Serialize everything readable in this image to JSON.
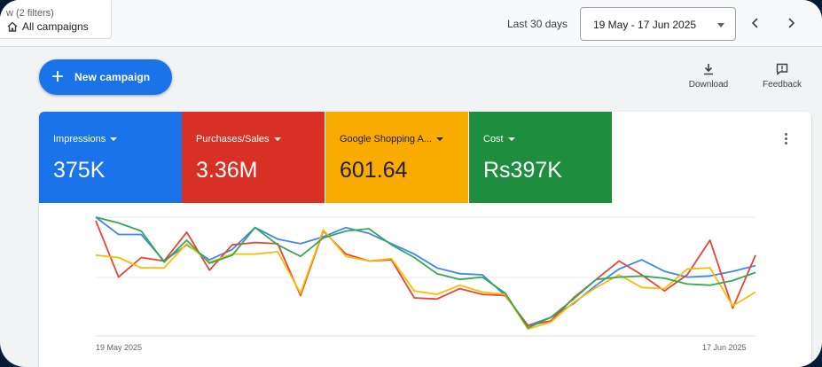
{
  "filter": {
    "hint": "w (2 filters)",
    "label": "All campaigns"
  },
  "date": {
    "range_label": "Last 30 days",
    "range": "19 May - 17 Jun 2025"
  },
  "toolbar": {
    "new_campaign": "New campaign",
    "download": "Download",
    "feedback": "Feedback"
  },
  "metrics": [
    {
      "label": "Impressions",
      "value": "375K",
      "color": "#1a73e8"
    },
    {
      "label": "Purchases/Sales",
      "value": "3.36M",
      "color": "#d93025"
    },
    {
      "label": "Google Shopping A...",
      "value": "601.64",
      "color": "#f9ab00"
    },
    {
      "label": "Cost",
      "value": "Rs397K",
      "color": "#1e8e3e"
    }
  ],
  "chart_data": {
    "type": "line",
    "x_start_label": "19 May 2025",
    "x_end_label": "17 Jun 2025",
    "grid": true,
    "series": [
      {
        "name": "Impressions",
        "color": "#4285f4",
        "values": [
          100,
          85,
          85,
          62,
          76,
          63,
          72,
          91,
          81,
          77,
          83,
          91,
          86,
          77,
          68,
          56,
          51,
          50,
          32,
          6,
          13,
          25,
          41,
          55,
          63,
          53,
          48,
          49,
          53,
          58
        ]
      },
      {
        "name": "Purchases/Sales",
        "color": "#ea4335",
        "values": [
          97,
          48,
          65,
          62,
          87,
          54,
          76,
          78,
          77,
          32,
          88,
          68,
          62,
          63,
          30,
          29,
          38,
          33,
          32,
          6,
          10,
          30,
          46,
          62,
          50,
          36,
          50,
          80,
          21,
          67
        ]
      },
      {
        "name": "Google Shopping A...",
        "color": "#fbbc04",
        "values": [
          67,
          65,
          56,
          56,
          77,
          61,
          68,
          68,
          70,
          34,
          89,
          66,
          62,
          64,
          36,
          33,
          41,
          35,
          33,
          3,
          9,
          26,
          39,
          50,
          39,
          38,
          55,
          56,
          23,
          35
        ]
      },
      {
        "name": "Cost",
        "color": "#34a853",
        "values": [
          100,
          95,
          88,
          61,
          80,
          60,
          67,
          91,
          76,
          66,
          82,
          88,
          90,
          76,
          65,
          51,
          46,
          48,
          34,
          4,
          13,
          29,
          46,
          48,
          49,
          47,
          42,
          41,
          45,
          52
        ]
      }
    ]
  }
}
